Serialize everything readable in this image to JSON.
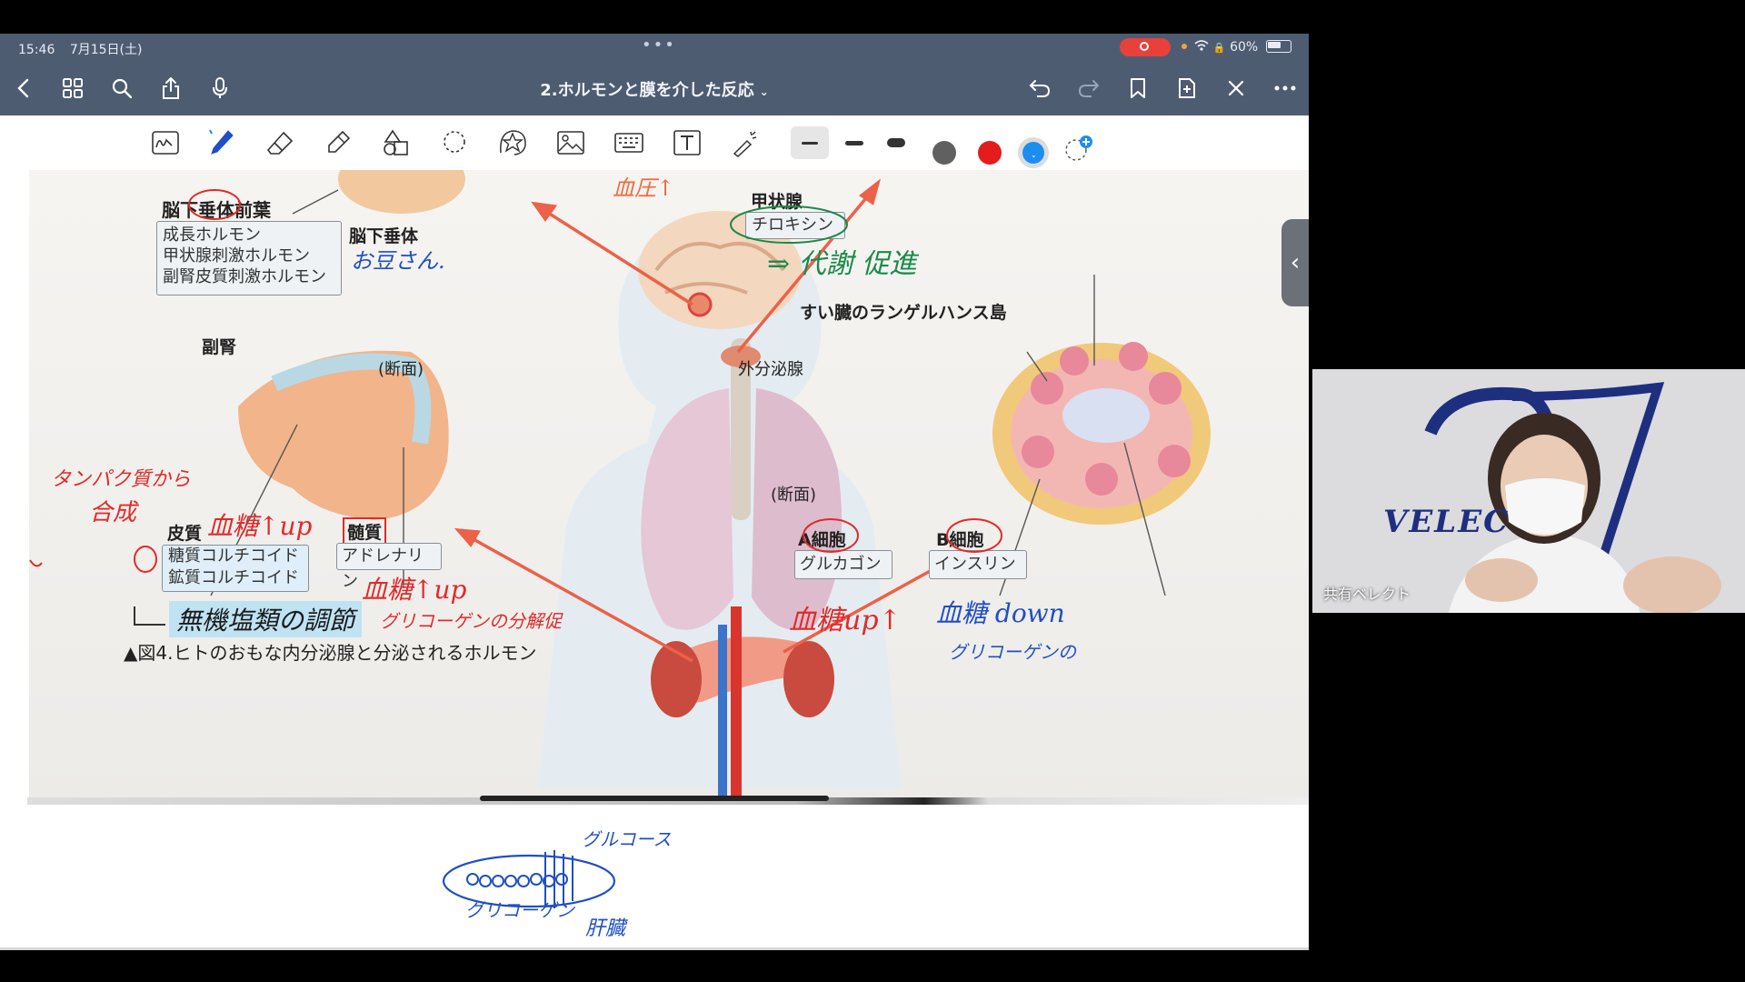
{
  "status_bar": {
    "time": "15:46",
    "date": "7月15日(土)",
    "battery": "60%"
  },
  "nav": {
    "title": "2.ホルモンと膜を介した反応"
  },
  "figure": {
    "caption": "▲図4.ヒトのおもな内分泌腺と分泌されるホルモン",
    "pituitary_anterior": "脳下垂体前葉",
    "pituitary_hormones": [
      "成長ホルモン",
      "甲状腺刺激ホルモン",
      "副腎皮質刺激ホルモン"
    ],
    "pituitary": "脳下垂体",
    "adrenal": "副腎",
    "cross_section": "(断面)",
    "cortex": "皮質",
    "medulla": "髄質",
    "cortex_hormones": [
      "糖質コルチコイド",
      "鉱質コルチコイド"
    ],
    "medulla_hormone": "アドレナリン",
    "thyroid": "甲状腺",
    "thyroid_hormone": "チロキシン",
    "pancreas_islet": "すい臓のランゲルハンス島",
    "exocrine": "外分泌腺",
    "a_cell": "A細胞",
    "b_cell": "B細胞",
    "glucagon": "グルカゴン",
    "insulin": "インスリン"
  },
  "annotations": {
    "pea": "お豆さん.",
    "bp_up": "血圧↑",
    "metabolism": "⇒ 代謝 促進",
    "protein": "タンパク質から",
    "synthesis": "合成",
    "sugar_up_1": "血糖↑up",
    "sugar_up_2": "血糖↑up",
    "glycogen_break": "グリコーゲンの分解促",
    "mineral": "無機塩類の調節",
    "sugar_up_3": "血糖up↑",
    "sugar_down": "血糖 down",
    "glycogen_right": "グリコーゲンの",
    "glucose": "グルコース",
    "glycogen_bottom": "グリコーゲン",
    "liver": "肝臓"
  },
  "webcam": {
    "name": "共有ベレクト",
    "logo_text": "VELEC"
  },
  "colors": {
    "bar": "#4e5c72",
    "red_pen": "#e02a2a",
    "blue_pen": "#1f4fc4",
    "rec": "#e8413c",
    "selected_blue": "#1c8ef0"
  }
}
